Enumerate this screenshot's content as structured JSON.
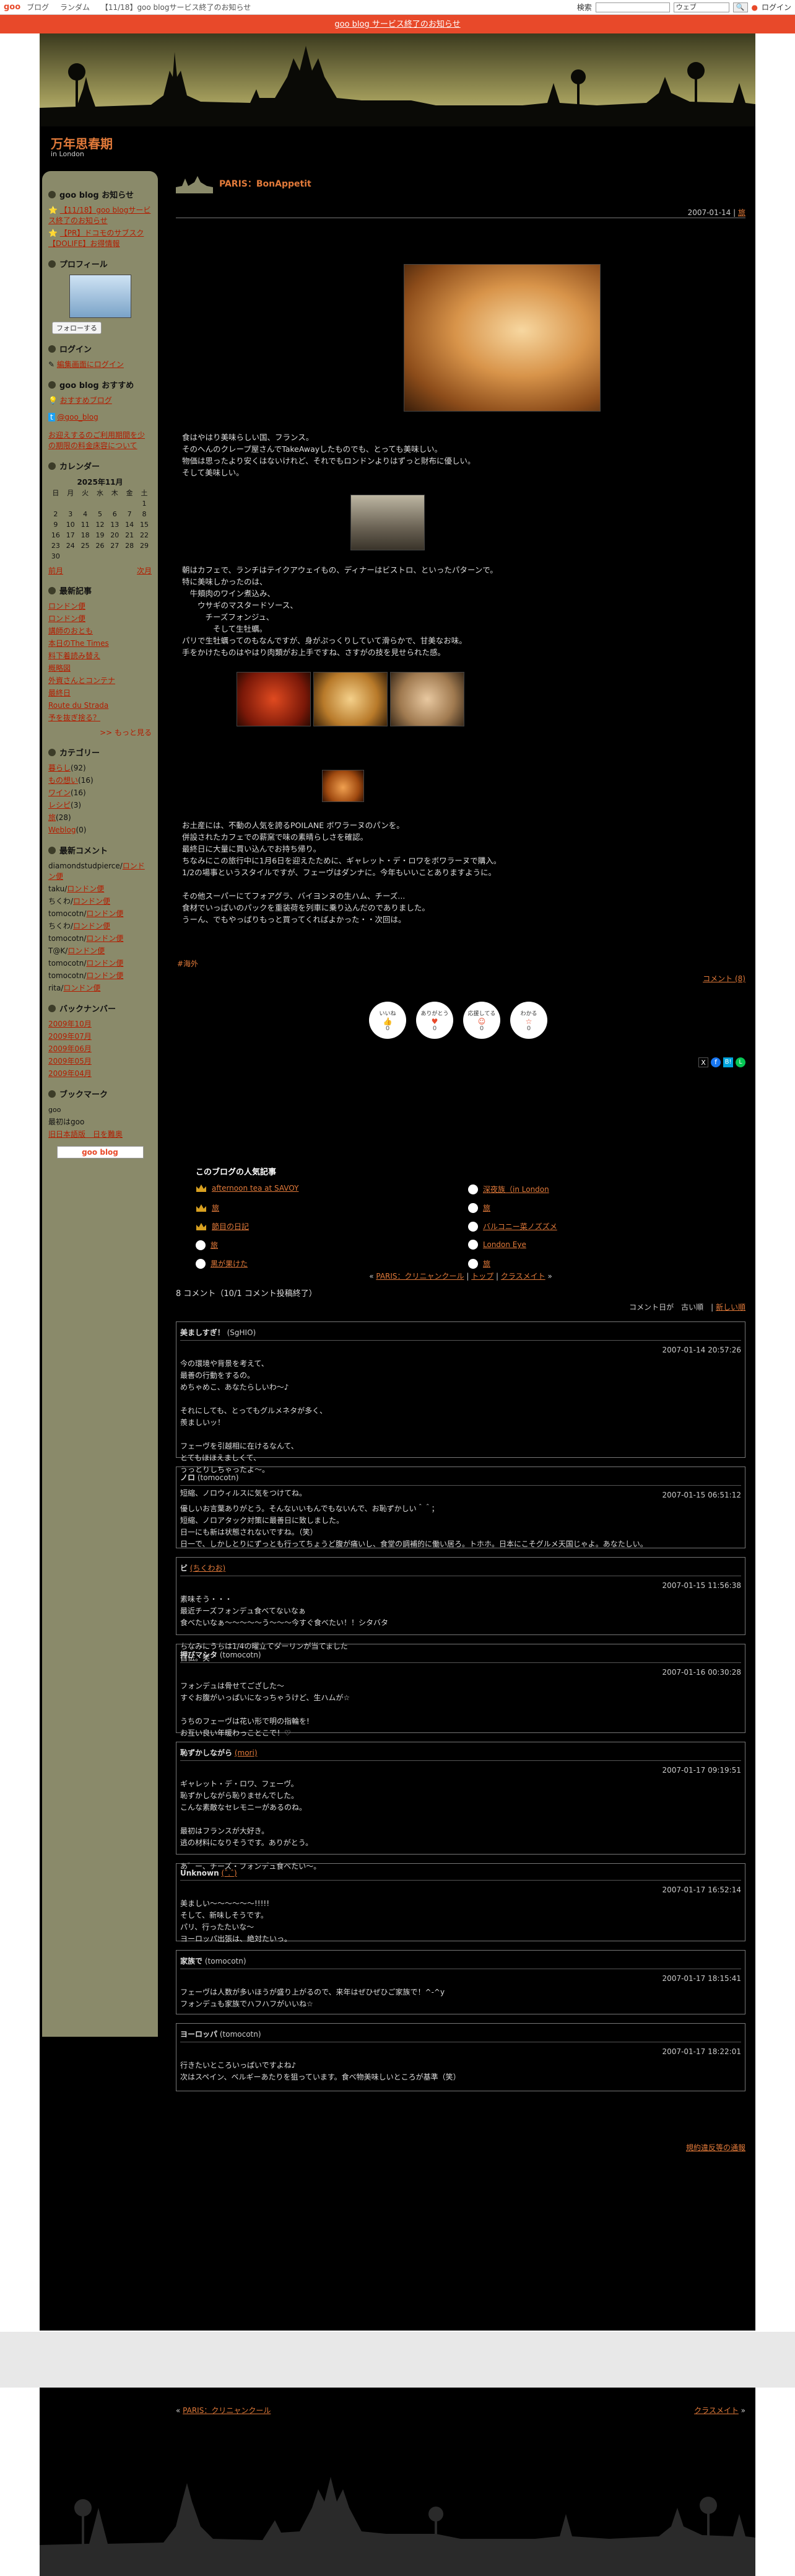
{
  "gbar": {
    "logo": "goo",
    "nav": [
      "ブログ",
      "ランダム",
      "【11/18】goo blogサービス終了のお知らせ"
    ],
    "search_label": "検索",
    "search_placeholder": "",
    "select_value": "ウェブ",
    "search_button": "",
    "login": "ログイン"
  },
  "notice": "goo blog サービス終了のお知らせ",
  "blog": {
    "title": "万年思春期",
    "subtitle": "in London"
  },
  "sidebar": {
    "notice_heading": "goo blog お知らせ",
    "notice_items": [
      "【11/18】goo blogサービス終了のお知らせ",
      "【PR】ドコモのサブスク【DOLIFE】お得情報"
    ],
    "profile_heading": "プロフィール",
    "follow": "フォローする",
    "login_heading": "ログイン",
    "login_link": "編集画面にログイン",
    "recommend_heading": "goo blog おすすめ",
    "recommend_link": "おすすめブログ",
    "twitter": "@goo_blog",
    "banner_text": "お迎えするのご利用期間を少の期限の料金床容について",
    "calendar_heading": "カレンダー",
    "calendar_month": "2025年11月",
    "calendar_days": [
      "日",
      "月",
      "火",
      "水",
      "木",
      "金",
      "土"
    ],
    "calendar_rows": [
      [
        "",
        "",
        "",
        "",
        "",
        "",
        "1"
      ],
      [
        "2",
        "3",
        "4",
        "5",
        "6",
        "7",
        "8"
      ],
      [
        "9",
        "10",
        "11",
        "12",
        "13",
        "14",
        "15"
      ],
      [
        "16",
        "17",
        "18",
        "19",
        "20",
        "21",
        "22"
      ],
      [
        "23",
        "24",
        "25",
        "26",
        "27",
        "28",
        "29"
      ],
      [
        "30",
        "",
        "",
        "",
        "",
        "",
        ""
      ]
    ],
    "cal_prev": "前月",
    "cal_next": "次月",
    "recent_heading": "最新記事",
    "recent_items": [
      "ロンドン便",
      "ロンドン便",
      "講師のおとも",
      "本日のThe Times",
      "料下着読み替え",
      "概略図",
      "外資さんとコンテナ",
      "最終日",
      "Route du Strada",
      "予を抜ぎ捨る？"
    ],
    "recent_more": ">> もっと見る",
    "category_heading": "カテゴリー",
    "categories": [
      {
        "name": "暮らし",
        "count": "(92)"
      },
      {
        "name": "もの想い",
        "count": "(16)"
      },
      {
        "name": "ワイン",
        "count": "(16)"
      },
      {
        "name": "レシピ",
        "count": "(3)"
      },
      {
        "name": "旅",
        "count": "(28)"
      },
      {
        "name": "Weblog",
        "count": "(0)"
      }
    ],
    "comments_heading": "最新コメント",
    "recent_comments": [
      {
        "who": "diamondstudpierce/",
        "link": "ロンドン便"
      },
      {
        "who": "taku/",
        "link": "ロンドン便"
      },
      {
        "who": "ちくわ/",
        "link": "ロンドン便"
      },
      {
        "who": "tomocotn/",
        "link": "ロンドン便"
      },
      {
        "who": "ちくわ/",
        "link": "ロンドン便"
      },
      {
        "who": "tomocotn/",
        "link": "ロンドン便"
      },
      {
        "who": "T@K/",
        "link": "ロンドン便"
      },
      {
        "who": "tomocotn/",
        "link": "ロンドン便"
      },
      {
        "who": "tomocotn/",
        "link": "ロンドン便"
      },
      {
        "who": "rita/",
        "link": "ロンドン便"
      }
    ],
    "backnumber_heading": "バックナンバー",
    "backnumbers": [
      "2009年10月",
      "2009年07月",
      "2009年06月",
      "2009年05月",
      "2009年04月"
    ],
    "bookmark_heading": "ブックマーク",
    "bookmark_label": "goo",
    "bookmarks": [
      "最初はgoo",
      "旧日本語版　日を難奥"
    ],
    "sb_button": "goo blog"
  },
  "post": {
    "title": "PARIS：BonAppetit",
    "date": "2007-01-14",
    "date_link": "旅",
    "para1": "食はやはり美味らしい国、フランス。\nそのへんのクレープ屋さんでTakeAwayしたものでも、とっても美味しい。\n物価は思ったより安くはないけれど、それでもロンドンよりはずっと財布に優しい。\nそして美味しい。",
    "para2": "朝はカフェで、ランチはテイクアウェイもの、ディナーはビストロ、といったパターンで。\n特に美味しかったのは、\n　牛頬肉のワイン煮込み、\n　　ウサギのマスタードソース、\n　　　チーズフォンジュ、\n　　　　そして生牡蠣。\nパリで生牡蠣ってのもなんですが、身がぷっくりしていて滑らかで、甘美なお味。\n手をかけたものはやはり肉類がお上手ですね、さすがの技を見せられた感。",
    "para3": "お土産には、不動の人気を誇るPOILANE ボワラーヌのパンを。\n併設されたカフェでの薪窯で味の素晴らしさを確認。\n最終日に大量に買い込んでお持ち帰り。\nちなみにこの旅行中に1月6日を迎えたために、ギャレット・デ・ロワをボワラーヌで購入。\n1/2の場事というスタイルですが、フェーヴはダンナに。今年もいいことありますように。",
    "para4": "その他スーパーにてフォアグラ、バイヨンヌの生ハム、チーズ...\n食材でいっぱいのパックを重装荷を列車に乗り込んだのでありました。\nうーん、でもやっぱりもっと買ってくればよかった・・次回は。",
    "tag": "#海外",
    "comment_link": "コメント (8)",
    "reactions": [
      {
        "label": "いいね",
        "count": "0"
      },
      {
        "label": "ありがとう",
        "count": "0"
      },
      {
        "label": "応援してる",
        "count": "0"
      },
      {
        "label": "わかる",
        "count": "0"
      }
    ],
    "nav_prev": "PARIS：クリニャンクール",
    "nav_top": "トップ",
    "nav_next": "クラスメイト"
  },
  "ranking": {
    "title": "このブログの人気記事",
    "left": [
      "afternoon tea at SAVOY",
      "旅",
      "節目の日記",
      "旅",
      "黒が果けた"
    ],
    "right": [
      "深夜族（in London",
      "旅",
      "バルコニー菜ノズズメ",
      "London Eye",
      "旅"
    ]
  },
  "comments_section": {
    "heading": "8 コメント（10/1 コメント投稿終了）",
    "sort_label": "コメント日が　古い順　|",
    "sort_link": "新しい順",
    "items": [
      {
        "name": "美ましすぎ！",
        "id": "(SgHIO)",
        "link": "",
        "date": "2007-01-14 20:57:26",
        "body": "今の環境や背景を考えて、\n最善の行動をするの。\nめちゃめこ、あなたらしいわ〜♪\n\nそれにしても、とってもグルメネタが多く、\n羨ましいッ！\n\nフェーヴを引越相に在けるなんて、\nとてもほほえましくて、\nうっとりしちゃったよ〜。\n\n短縮、ノロウィルスに気をつけてね。"
      },
      {
        "name": "ノロ",
        "id": "(tomocotn)",
        "link": "",
        "date": "2007-01-15 06:51:12",
        "body": "優しいお言葉ありがとう。そんないいもんでもないんで、お恥ずかしい＾＾；\n短縮、ノロアタック対策に最善日に致しました。\n日一にも新は状態されないですね。（笑）\n日一で、しかしとりにずっとも行ってちょうど腹が痛いし、食堂の調補的に働い居ろ。トホホ。日本にこそグルメ天国じゃよ。あなたしい。"
      },
      {
        "name": "ビ",
        "id": "",
        "link": "(ちくわお)",
        "date": "2007-01-15 11:56:38",
        "body": "素味そう・・・\n最近チーズフォンデュ食べてないなぁ\n食べたいなぁ〜〜〜〜〜う〜〜〜今すぐ食べたい！！シタバタ\n\nちなみにうちは1/4の曜立てダーリンが当てました\n自伝。笑"
      },
      {
        "name": "押びマシタ",
        "id": "(tomocotn)",
        "link": "",
        "date": "2007-01-16 00:30:28",
        "body": "フォンデュは骨せてござした〜\nすぐお腹がいっぱいになっちゃうけど、生ハムが☆\n\nうちのフェーヴは花い形で明の指輪を!\nお互い良い年暖わっことこで！♡"
      },
      {
        "name": "恥ずかしながら",
        "id": "",
        "link": "(mori)",
        "date": "2007-01-17 09:19:51",
        "body": "ギャレット・デ・ロワ、フェーヴ。\n恥ずかしながら恥りませんでした。\nこんな素敵なセレモニーがあるのね。\n\n最初はフランスが大好き。\n逃の材料になりそうです。ありがとう。\n\nあ゛ー、チーズ・フォンデュ食べたい〜。"
      },
      {
        "name": "Unknown",
        "id": "",
        "link": "(ˆ.ˆ)",
        "date": "2007-01-17 16:52:14",
        "body": "美ましい〜〜〜〜〜〜!!!!!\nそして、新味しそうです。\nパリ、行ったたいな〜\nヨーロッパ出張は、絶対たいっ。"
      },
      {
        "name": "家族で",
        "id": "(tomocotn)",
        "link": "",
        "date": "2007-01-17 18:15:41",
        "body": "フェーヴは人数が多いほうが盛り上がるので、来年はぜひぜひご家族で！^-^y\nフォンデュも家族でハフハフがいいね☆"
      },
      {
        "name": "ヨーロッパ",
        "id": "(tomocotn)",
        "link": "",
        "date": "2007-01-17 18:22:01",
        "body": "行きたいところいっぱいですよね♪\n次はスペイン、ベルギーあたりを狙っています。食べ物美味しいところが基準（笑）"
      }
    ],
    "terms_link": "規約違反等の通報"
  },
  "footer": {
    "prev": "PARIS：クリニャンクール",
    "next": "クラスメイト"
  }
}
